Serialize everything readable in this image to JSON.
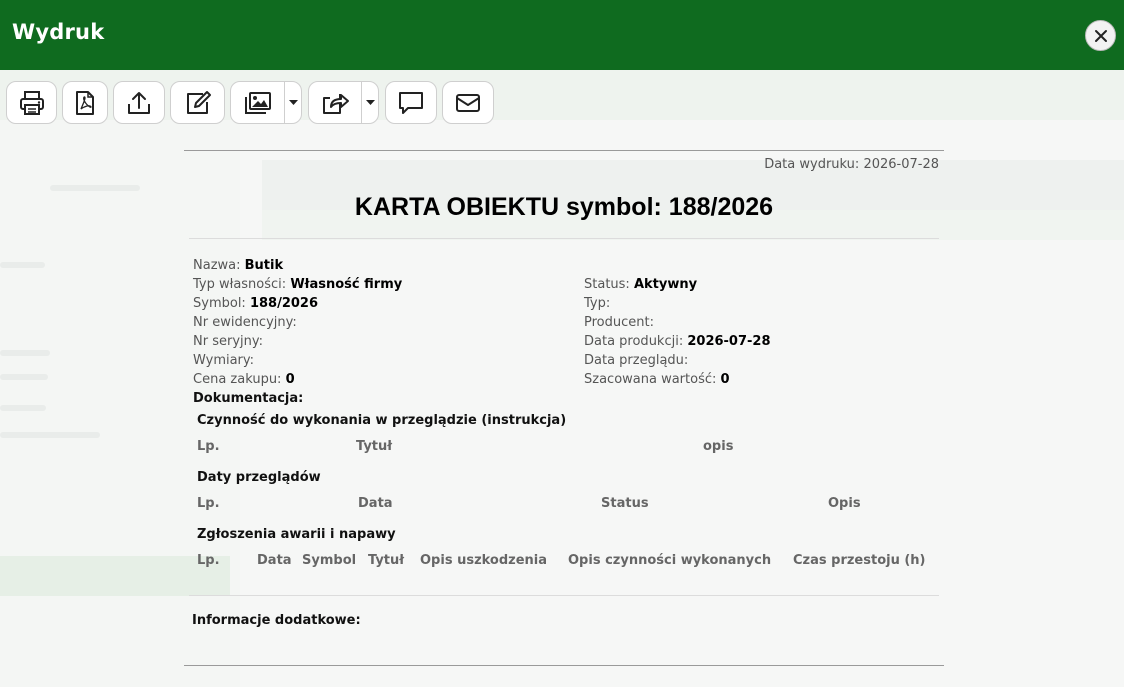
{
  "window": {
    "title": "Wydruk"
  },
  "toolbar": {
    "buttons": [
      {
        "icon": "printer-icon"
      },
      {
        "icon": "pdf-icon"
      },
      {
        "icon": "upload-icon"
      },
      {
        "icon": "edit-icon"
      },
      {
        "icon": "images-icon"
      },
      {
        "icon": "share-icon"
      },
      {
        "icon": "comment-icon"
      },
      {
        "icon": "mail-icon"
      }
    ]
  },
  "document": {
    "print_date_label": "Data wydruku:",
    "print_date": "2026-07-28",
    "title": "KARTA OBIEKTU symbol: 188/2026",
    "left_fields": [
      {
        "label": "Nazwa:",
        "value": "Butik"
      },
      {
        "label": "Typ własności:",
        "value": "Własność firmy"
      },
      {
        "label": "Symbol:",
        "value": "188/2026"
      },
      {
        "label": "Nr ewidencyjny:",
        "value": ""
      },
      {
        "label": "Nr seryjny:",
        "value": ""
      },
      {
        "label": "Wymiary:",
        "value": ""
      },
      {
        "label": "Cena zakupu:",
        "value": "0"
      }
    ],
    "right_fields": [
      {
        "label": "Status:",
        "value": "Aktywny"
      },
      {
        "label": "Typ:",
        "value": ""
      },
      {
        "label": "Producent:",
        "value": ""
      },
      {
        "label": "Data produkcji:",
        "value": "2026-07-28"
      },
      {
        "label": "Data przeglądu:",
        "value": ""
      },
      {
        "label": "Szacowana wartość:",
        "value": "0"
      }
    ],
    "documentation_label": "Dokumentacja:",
    "sections": {
      "instructions": {
        "title": "Czynność do wykonania w przeglądzie (instrukcja)",
        "columns": [
          "Lp.",
          "Tytuł",
          "opis"
        ]
      },
      "inspections": {
        "title": "Daty przeglądów",
        "columns": [
          "Lp.",
          "Data",
          "Status",
          "Opis"
        ]
      },
      "failures": {
        "title": "Zgłoszenia awarii i napawy",
        "columns": [
          "Lp.",
          "Data",
          "Symbol",
          "Tytuł",
          "Opis uszkodzenia",
          "Opis czynności wykonanych",
          "Czas przestoju (h)"
        ]
      }
    },
    "additional_info_label": "Informacje dodatkowe:"
  }
}
